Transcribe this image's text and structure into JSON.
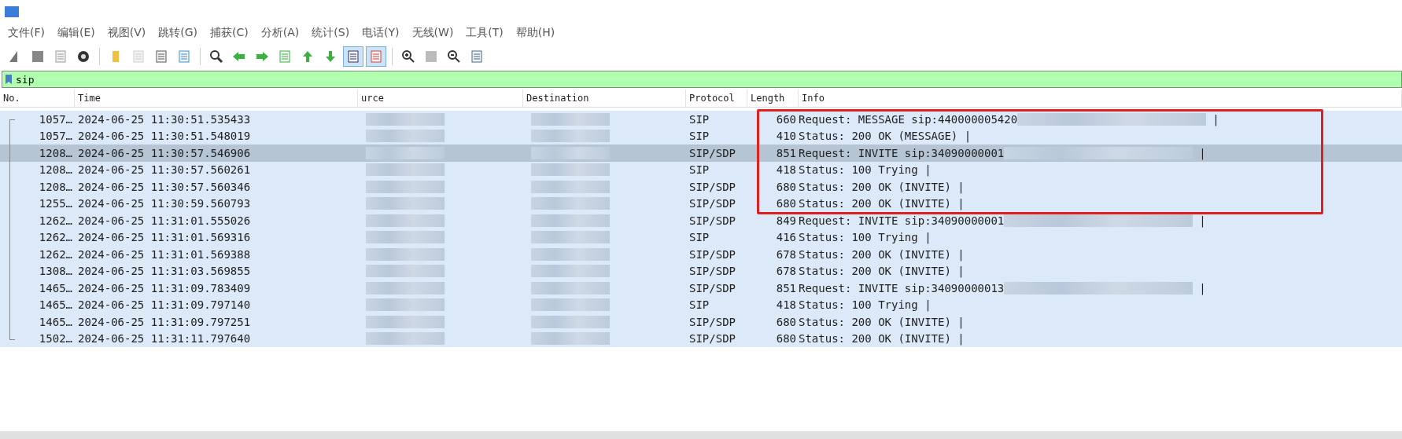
{
  "menu": [
    "文件(F)",
    "编辑(E)",
    "视图(V)",
    "跳转(G)",
    "捕获(C)",
    "分析(A)",
    "统计(S)",
    "电话(Y)",
    "无线(W)",
    "工具(T)",
    "帮助(H)"
  ],
  "toolbar": [
    {
      "pressed": false
    },
    {
      "pressed": false
    },
    {
      "pressed": false
    },
    {
      "pressed": false
    },
    {
      "pressed": false
    },
    {
      "pressed": false
    },
    {
      "pressed": false
    },
    {
      "pressed": false
    },
    {
      "pressed": false
    },
    {
      "pressed": false
    },
    {
      "pressed": false
    },
    {
      "pressed": false
    },
    {
      "pressed": false
    },
    {
      "pressed": false
    },
    {
      "pressed": true
    },
    {
      "pressed": true
    },
    {
      "pressed": false
    },
    {
      "pressed": false
    },
    {
      "pressed": false
    },
    {
      "pressed": false
    }
  ],
  "filter": {
    "value": "sip"
  },
  "columns": [
    {
      "label": "No."
    },
    {
      "label": "Time"
    },
    {
      "label": "urce",
      "redacted": true
    },
    {
      "label": "Destination",
      "redacted": true
    },
    {
      "label": "Protocol"
    },
    {
      "label": "Length"
    },
    {
      "label": "Info"
    }
  ],
  "rows": [
    {
      "no": "1057…",
      "time": "2024-06-25 11:30:51.535433",
      "protocol": "SIP",
      "length": "660",
      "info": "Request: MESSAGE sip:440000005420",
      "info_redacted": true,
      "tail": "|",
      "selected": false,
      "boxed": true
    },
    {
      "no": "1057…",
      "time": "2024-06-25 11:30:51.548019",
      "protocol": "SIP",
      "length": "410",
      "info": "Status: 200 OK (MESSAGE) |",
      "info_redacted": false,
      "selected": false,
      "boxed": true
    },
    {
      "no": "1208…",
      "time": "2024-06-25 11:30:57.546906",
      "protocol": "SIP/SDP",
      "length": "851",
      "info": "Request: INVITE sip:34090000001",
      "info_redacted": true,
      "tail": "|",
      "selected": true,
      "boxed": true
    },
    {
      "no": "1208…",
      "time": "2024-06-25 11:30:57.560261",
      "protocol": "SIP",
      "length": "418",
      "info": "Status: 100 Trying |",
      "info_redacted": false,
      "selected": false,
      "boxed": true
    },
    {
      "no": "1208…",
      "time": "2024-06-25 11:30:57.560346",
      "protocol": "SIP/SDP",
      "length": "680",
      "info": "Status: 200 OK (INVITE) |",
      "info_redacted": false,
      "selected": false,
      "boxed": true
    },
    {
      "no": "1255…",
      "time": "2024-06-25 11:30:59.560793",
      "protocol": "SIP/SDP",
      "length": "680",
      "info": "Status: 200 OK (INVITE) |",
      "info_redacted": false,
      "selected": false,
      "boxed": true
    },
    {
      "no": "1262…",
      "time": "2024-06-25 11:31:01.555026",
      "protocol": "SIP/SDP",
      "length": "849",
      "info": "Request: INVITE sip:34090000001",
      "info_redacted": true,
      "tail": "|",
      "selected": false,
      "boxed": false
    },
    {
      "no": "1262…",
      "time": "2024-06-25 11:31:01.569316",
      "protocol": "SIP",
      "length": "416",
      "info": "Status: 100 Trying |",
      "info_redacted": false,
      "selected": false,
      "boxed": false
    },
    {
      "no": "1262…",
      "time": "2024-06-25 11:31:01.569388",
      "protocol": "SIP/SDP",
      "length": "678",
      "info": "Status: 200 OK (INVITE) |",
      "info_redacted": false,
      "selected": false,
      "boxed": false
    },
    {
      "no": "1308…",
      "time": "2024-06-25 11:31:03.569855",
      "protocol": "SIP/SDP",
      "length": "678",
      "info": "Status: 200 OK (INVITE) |",
      "info_redacted": false,
      "selected": false,
      "boxed": false
    },
    {
      "no": "1465…",
      "time": "2024-06-25 11:31:09.783409",
      "protocol": "SIP/SDP",
      "length": "851",
      "info": "Request: INVITE sip:34090000013",
      "info_redacted": true,
      "tail": "|",
      "selected": false,
      "boxed": false
    },
    {
      "no": "1465…",
      "time": "2024-06-25 11:31:09.797140",
      "protocol": "SIP",
      "length": "418",
      "info": "Status: 100 Trying |",
      "info_redacted": false,
      "selected": false,
      "boxed": false
    },
    {
      "no": "1465…",
      "time": "2024-06-25 11:31:09.797251",
      "protocol": "SIP/SDP",
      "length": "680",
      "info": "Status: 200 OK (INVITE) |",
      "info_redacted": false,
      "selected": false,
      "boxed": false
    },
    {
      "no": "1502…",
      "time": "2024-06-25 11:31:11.797640",
      "protocol": "SIP/SDP",
      "length": "680",
      "info": "Status: 200 OK (INVITE) |",
      "info_redacted": false,
      "selected": false,
      "boxed": false
    }
  ]
}
